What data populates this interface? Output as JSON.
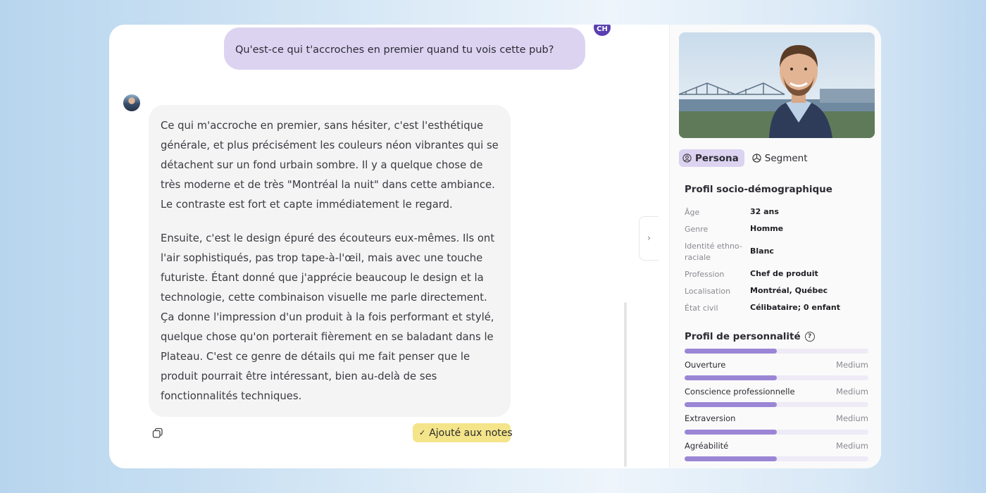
{
  "chat": {
    "user_avatar_initials": "CH",
    "user_message": "Qu'est-ce qui t'accroches en premier quand tu vois cette pub?",
    "bot_paragraphs": [
      "Ce qui m'accroche en premier, sans hésiter, c'est l'esthétique générale, et plus précisément les couleurs néon vibrantes qui se détachent sur un fond urbain sombre. Il y a quelque chose de très moderne et de très \"Montréal la nuit\" dans cette ambiance. Le contraste est fort et capte immédiatement le regard.",
      "Ensuite, c'est le design épuré des écouteurs eux-mêmes. Ils ont l'air sophistiqués, pas trop tape-à-l'œil, mais avec une touche futuriste. Étant donné que j'apprécie beaucoup le design et la technologie, cette combinaison visuelle me parle directement. Ça donne l'impression d'un produit à la fois performant et stylé, quelque chose qu'on porterait fièrement en se baladant dans le Plateau. C'est ce genre de détails qui me fait penser que le produit pourrait être intéressant, bien au-delà de ses fonctionnalités techniques."
    ],
    "note_badge_label": "Ajouté aux notes",
    "collapse_icon": "chevron-right-icon"
  },
  "panel": {
    "tabs": [
      {
        "label": "Persona",
        "icon": "user-circle-icon",
        "active": true
      },
      {
        "label": "Segment",
        "icon": "pie-chart-icon",
        "active": false
      }
    ],
    "socio": {
      "title": "Profil socio-démographique",
      "rows": [
        {
          "label": "Âge",
          "value": "32 ans"
        },
        {
          "label": "Genre",
          "value": "Homme"
        },
        {
          "label": "Identité ethno-raciale",
          "value": "Blanc"
        },
        {
          "label": "Profession",
          "value": "Chef de produit"
        },
        {
          "label": "Localisation",
          "value": "Montréal, Québec"
        },
        {
          "label": "État civil",
          "value": "Célibataire; 0 enfant"
        }
      ]
    },
    "personality": {
      "title": "Profil de personnalité",
      "help_icon": "?",
      "traits": [
        {
          "name": "Ouverture",
          "level": "Medium",
          "fill": 0.5
        },
        {
          "name": "Conscience professionnelle",
          "level": "Medium",
          "fill": 0.5
        },
        {
          "name": "Extraversion",
          "level": "Medium",
          "fill": 0.5
        },
        {
          "name": "Agréabilité",
          "level": "Medium",
          "fill": 0.5
        }
      ],
      "top_bar_fill": 0.5
    }
  },
  "colors": {
    "accent_purple": "#9b86d6",
    "user_bubble": "#dcd3f1",
    "note_badge": "#f4e48a"
  }
}
